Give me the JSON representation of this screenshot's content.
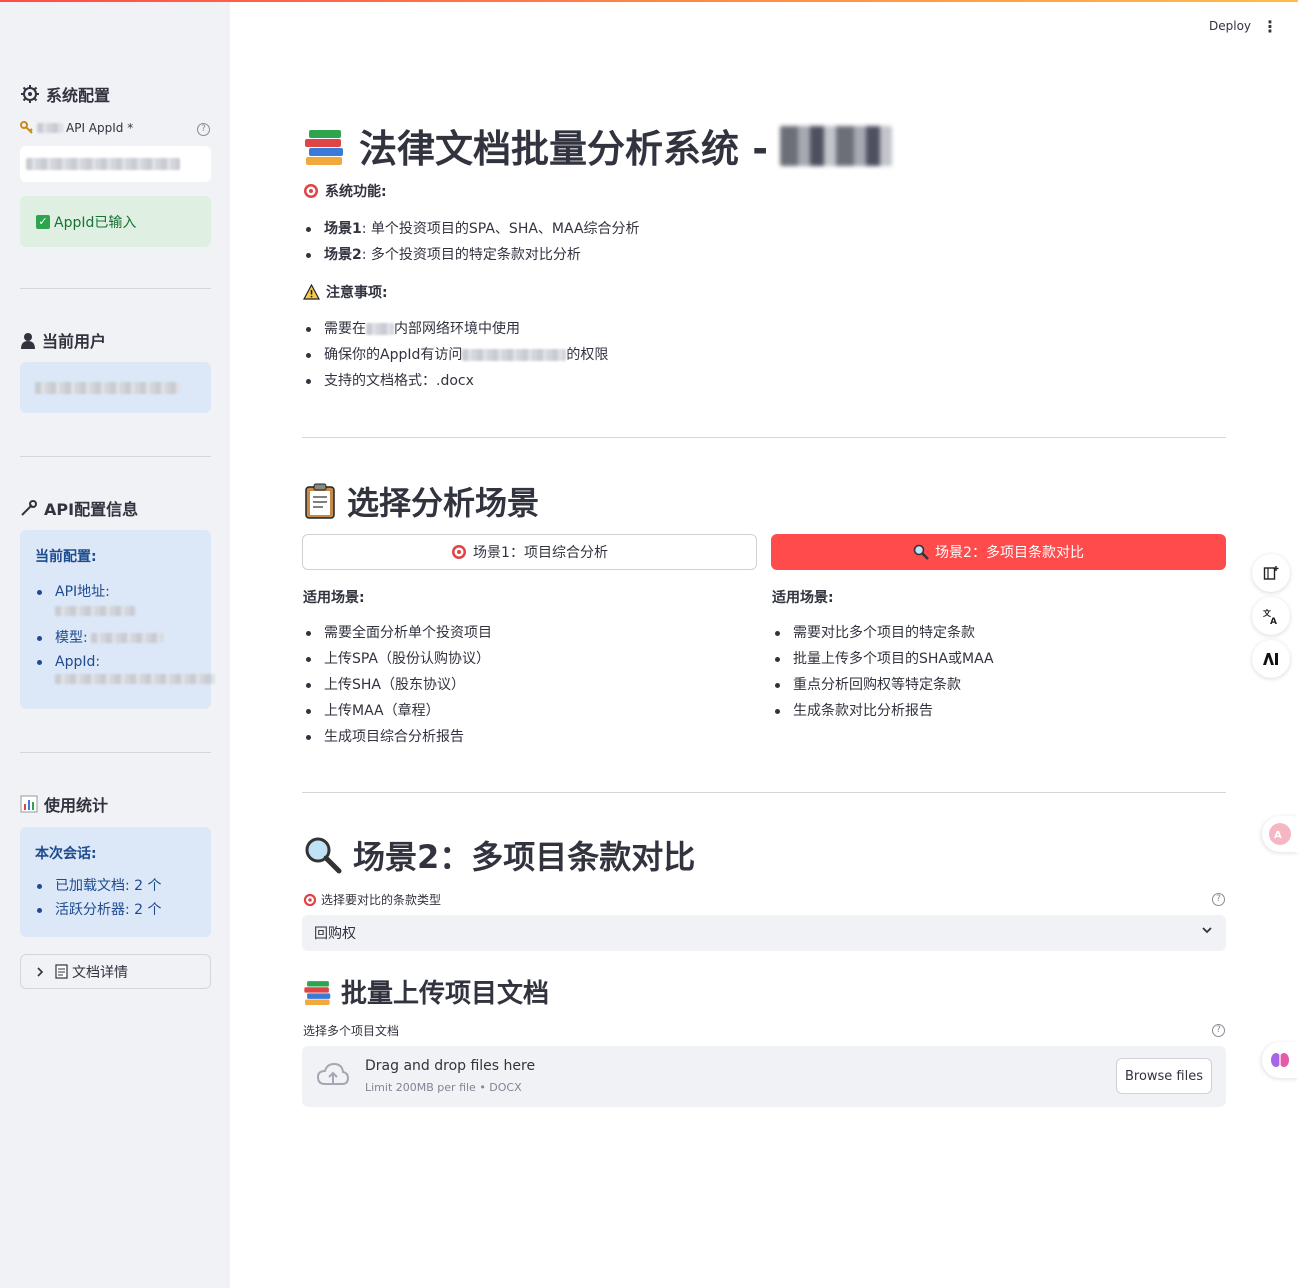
{
  "header": {
    "deploy_label": "Deploy",
    "menu_icon": "⋮"
  },
  "sidebar": {
    "system_config_title": "系统配置",
    "appid_label": "API AppId *",
    "appid_status": "AppId已输入",
    "current_user_title": "当前用户",
    "api_info_title": "API配置信息",
    "api_info": {
      "heading": "当前配置:",
      "items": [
        "API地址:",
        "模型:",
        "AppId:"
      ]
    },
    "usage_title": "使用统计",
    "usage": {
      "heading": "本次会话:",
      "items": [
        "已加载文档: 2 个",
        "活跃分析器: 2 个"
      ]
    },
    "expander_label": "文档详情"
  },
  "main": {
    "title": "法律文档批量分析系统 -",
    "features_heading": "系统功能:",
    "features": [
      {
        "bold": "场景1",
        "text": ": 单个投资项目的SPA、SHA、MAA综合分析"
      },
      {
        "bold": "场景2",
        "text": ": 多个投资项目的特定条款对比分析"
      }
    ],
    "notes_heading": "注意事项:",
    "notes": [
      {
        "before": "需要在",
        "after": "内部网络环境中使用"
      },
      {
        "before": "确保你的AppId有访问",
        "after": "的权限"
      },
      {
        "before": "支持的文档格式：.docx",
        "after": ""
      }
    ],
    "choose_title": "选择分析场景",
    "scenario1_button": "场景1：项目综合分析",
    "scenario2_button": "场景2：多项目条款对比",
    "col1": {
      "heading": "适用场景:",
      "items": [
        "需要全面分析单个投资项目",
        "上传SPA（股份认购协议）",
        "上传SHA（股东协议）",
        "上传MAA（章程）",
        "生成项目综合分析报告"
      ]
    },
    "col2": {
      "heading": "适用场景:",
      "items": [
        "需要对比多个项目的特定条款",
        "批量上传多个项目的SHA或MAA",
        "重点分析回购权等特定条款",
        "生成条款对比分析报告"
      ]
    },
    "scenario2_title": "场景2：多项目条款对比",
    "clause_select_label": "选择要对比的条款类型",
    "clause_select_value": "回购权",
    "upload_title": "批量上传项目文档",
    "upload_label": "选择多个项目文档",
    "dropzone_main": "Drag and drop files here",
    "dropzone_sub": "Limit 200MB per file • DOCX",
    "browse_label": "Browse files"
  },
  "colors": {
    "primary": "#ff4b4b",
    "sidebar_bg": "#f0f2f6",
    "info_bg": "#dce8f7",
    "success_bg": "#dff0e3"
  },
  "icons": {
    "gear": "gear-icon",
    "key": "key-icon",
    "user": "user-icon",
    "wrench": "wrench-icon",
    "chart": "bar-chart-icon",
    "books": "books-icon",
    "target": "target-icon",
    "warning": "warning-icon",
    "clipboard": "clipboard-icon",
    "magnifier": "magnifier-icon",
    "upload_cloud": "upload-cloud-icon"
  }
}
